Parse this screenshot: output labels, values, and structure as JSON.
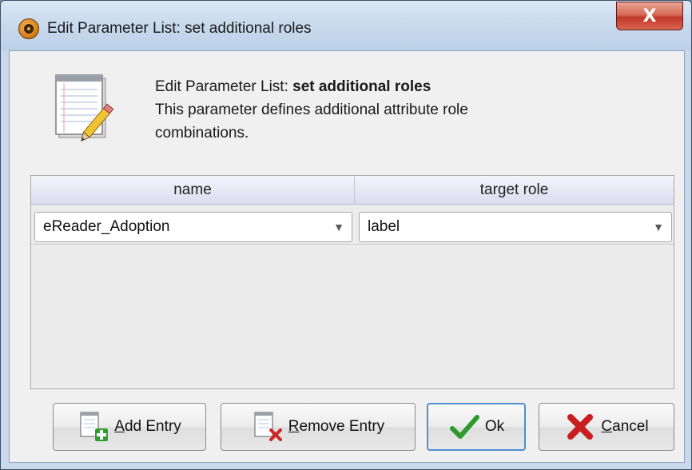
{
  "window": {
    "title": "Edit Parameter List: set additional roles",
    "close_glyph": "X"
  },
  "header": {
    "line1_prefix": "Edit Parameter List: ",
    "line1_bold": "set additional roles",
    "line2": "This parameter defines additional attribute role",
    "line3": "combinations.",
    "icon": "notepad-pencil-icon"
  },
  "table": {
    "columns": [
      "name",
      "target role"
    ],
    "rows": [
      {
        "name": "eReader_Adoption",
        "target_role": "label"
      }
    ]
  },
  "buttons": {
    "add": {
      "mnemonic": "A",
      "rest": "dd Entry",
      "icon": "add-entry-icon"
    },
    "remove": {
      "mnemonic": "R",
      "rest": "emove Entry",
      "icon": "remove-entry-icon"
    },
    "ok": {
      "label": "Ok",
      "icon": "checkmark-icon"
    },
    "cancel": {
      "mnemonic": "C",
      "rest": "ancel",
      "icon": "cancel-x-icon"
    }
  },
  "colors": {
    "titlebar": "#c6d8ec",
    "close": "#c0392b",
    "ok_check": "#2e9a2e",
    "cancel_x": "#c81e1e",
    "header_row": "#dcdcf0"
  }
}
